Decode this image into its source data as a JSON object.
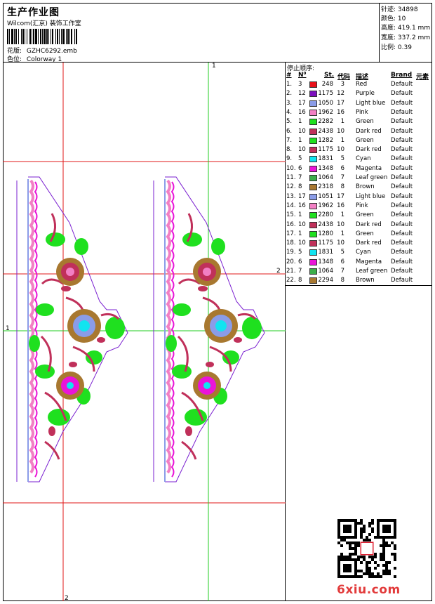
{
  "header": {
    "title": "生产作业图",
    "subtitle": "Wilcom(汇京) 装饰工作室",
    "design_label": "花版:",
    "design_value": "GZHC6292.emb",
    "colorway_label": "色位:",
    "colorway_value": "Colorway 1"
  },
  "stats": [
    {
      "label": "针迹:",
      "value": "34898"
    },
    {
      "label": "颜色:",
      "value": "10"
    },
    {
      "label": "高度:",
      "value": "419.1 mm"
    },
    {
      "label": "宽度:",
      "value": "337.2 mm"
    },
    {
      "label": "比例:",
      "value": "0.39"
    }
  ],
  "sequence": {
    "title": "停止顺序:",
    "headers": {
      "num": "#",
      "no": "N⁰",
      "st": "St.",
      "code": "代码",
      "desc": "描述",
      "brand": "Brand",
      "elem": "元素"
    },
    "rows": [
      {
        "n": "1.",
        "no": "3",
        "st": "248",
        "code": "3",
        "desc": "Red",
        "brand": "Default",
        "color": "#e8101a"
      },
      {
        "n": "2.",
        "no": "12",
        "st": "1175",
        "code": "12",
        "desc": "Purple",
        "brand": "Default",
        "color": "#7c0fbe"
      },
      {
        "n": "3.",
        "no": "17",
        "st": "1050",
        "code": "17",
        "desc": "Light blue",
        "brand": "Default",
        "color": "#8a9ce8"
      },
      {
        "n": "4.",
        "no": "16",
        "st": "1962",
        "code": "16",
        "desc": "Pink",
        "brand": "Default",
        "color": "#f27fc4"
      },
      {
        "n": "5.",
        "no": "1",
        "st": "2282",
        "code": "1",
        "desc": "Green",
        "brand": "Default",
        "color": "#1fe01f"
      },
      {
        "n": "6.",
        "no": "10",
        "st": "2438",
        "code": "10",
        "desc": "Dark red",
        "brand": "Default",
        "color": "#c0305a"
      },
      {
        "n": "7.",
        "no": "1",
        "st": "1282",
        "code": "1",
        "desc": "Green",
        "brand": "Default",
        "color": "#1fe01f"
      },
      {
        "n": "8.",
        "no": "10",
        "st": "1175",
        "code": "10",
        "desc": "Dark red",
        "brand": "Default",
        "color": "#c0305a"
      },
      {
        "n": "9.",
        "no": "5",
        "st": "1831",
        "code": "5",
        "desc": "Cyan",
        "brand": "Default",
        "color": "#11e4f0"
      },
      {
        "n": "10.",
        "no": "6",
        "st": "1348",
        "code": "6",
        "desc": "Magenta",
        "brand": "Default",
        "color": "#ea14d8"
      },
      {
        "n": "11.",
        "no": "7",
        "st": "1064",
        "code": "7",
        "desc": "Leaf green",
        "brand": "Default",
        "color": "#3cae4a"
      },
      {
        "n": "12.",
        "no": "8",
        "st": "2318",
        "code": "8",
        "desc": "Brown",
        "brand": "Default",
        "color": "#a87830"
      },
      {
        "n": "13.",
        "no": "17",
        "st": "1051",
        "code": "17",
        "desc": "Light blue",
        "brand": "Default",
        "color": "#8a9ce8"
      },
      {
        "n": "14.",
        "no": "16",
        "st": "1962",
        "code": "16",
        "desc": "Pink",
        "brand": "Default",
        "color": "#f27fc4"
      },
      {
        "n": "15.",
        "no": "1",
        "st": "2280",
        "code": "1",
        "desc": "Green",
        "brand": "Default",
        "color": "#1fe01f"
      },
      {
        "n": "16.",
        "no": "10",
        "st": "2438",
        "code": "10",
        "desc": "Dark red",
        "brand": "Default",
        "color": "#c0305a"
      },
      {
        "n": "17.",
        "no": "1",
        "st": "1280",
        "code": "1",
        "desc": "Green",
        "brand": "Default",
        "color": "#1fe01f"
      },
      {
        "n": "18.",
        "no": "10",
        "st": "1175",
        "code": "10",
        "desc": "Dark red",
        "brand": "Default",
        "color": "#c0305a"
      },
      {
        "n": "19.",
        "no": "5",
        "st": "1831",
        "code": "5",
        "desc": "Cyan",
        "brand": "Default",
        "color": "#11e4f0"
      },
      {
        "n": "20.",
        "no": "6",
        "st": "1348",
        "code": "6",
        "desc": "Magenta",
        "brand": "Default",
        "color": "#ea14d8"
      },
      {
        "n": "21.",
        "no": "7",
        "st": "1064",
        "code": "7",
        "desc": "Leaf green",
        "brand": "Default",
        "color": "#3cae4a"
      },
      {
        "n": "22.",
        "no": "8",
        "st": "2294",
        "code": "8",
        "desc": "Brown",
        "brand": "Default",
        "color": "#a87830"
      }
    ]
  },
  "axis_labels": {
    "green_top": "1",
    "green_left": "1",
    "red_right": "2",
    "red_bottom": "2"
  },
  "logo": "6xiu.com",
  "colors": {
    "guide_red": "#e01818",
    "guide_green": "#22cc22",
    "outline_purple": "#7a1fd0"
  }
}
